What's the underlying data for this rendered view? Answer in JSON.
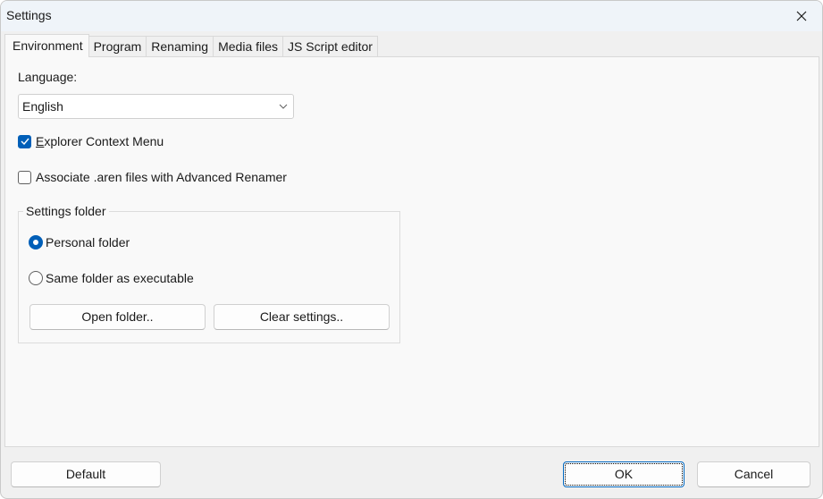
{
  "window": {
    "title": "Settings",
    "close_label": "Close"
  },
  "tabs": [
    {
      "label": "Environment",
      "active": true
    },
    {
      "label": "Program",
      "active": false
    },
    {
      "label": "Renaming",
      "active": false
    },
    {
      "label": "Media files",
      "active": false
    },
    {
      "label": "JS Script editor",
      "active": false
    }
  ],
  "environment": {
    "language_label": "Language:",
    "language_value": "English",
    "explorer_menu": {
      "label_first": "E",
      "label_rest": "xplorer Context Menu",
      "checked": true
    },
    "associate": {
      "label": "Associate .aren files with Advanced Renamer",
      "checked": false
    },
    "settings_folder": {
      "title": "Settings folder",
      "options": [
        {
          "label": "Personal folder",
          "selected": true
        },
        {
          "label": "Same folder as executable",
          "selected": false
        }
      ],
      "open_folder_label": "Open folder..",
      "clear_settings_label": "Clear settings.."
    }
  },
  "footer": {
    "default_label": "Default",
    "ok_label": "OK",
    "cancel_label": "Cancel"
  },
  "colors": {
    "accent": "#005fb8",
    "focus_border": "#0067c0"
  }
}
